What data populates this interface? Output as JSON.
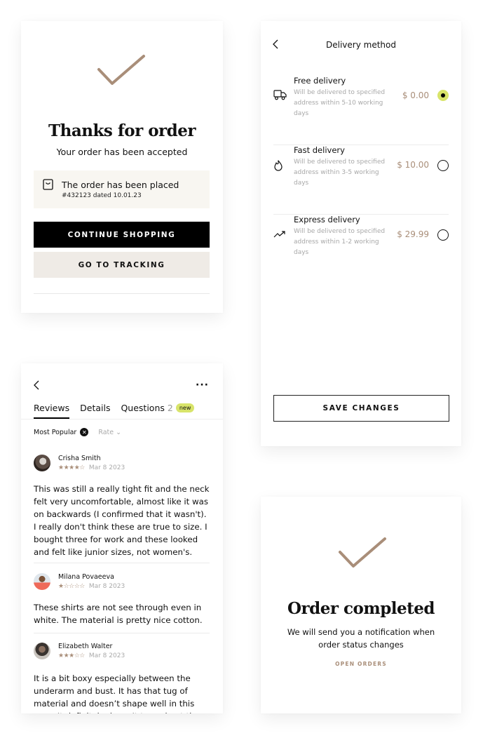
{
  "colors": {
    "accent": "#a98e79",
    "highlight": "#d8e46a",
    "panel": "#f8f6f1",
    "secondary_button": "#efebe6"
  },
  "thanks": {
    "icon": "checkmark-icon",
    "title": "Thanks for order",
    "subtitle": "Your order has been accepted",
    "placed_title": "The order has been placed",
    "placed_detail": "#432123 dated 10.01.23",
    "continue_label": "CONTINUE SHOPPING",
    "tracking_label": "GO TO TRACKING"
  },
  "delivery": {
    "title": "Delivery method",
    "options": [
      {
        "name": "Free delivery",
        "desc": "Will be delivered to specified address within 5-10 working days",
        "price": "$ 0.00",
        "icon": "truck-icon",
        "selected": true
      },
      {
        "name": "Fast delivery",
        "desc": "Will be delivered to specified address within 3-5 working days",
        "price": "$ 10.00",
        "icon": "fire-icon",
        "selected": false
      },
      {
        "name": "Express delivery",
        "desc": "Will be delivered to specified address within 1-2 working days",
        "price": "$ 29.99",
        "icon": "trending-up-icon",
        "selected": false
      }
    ],
    "save_label": "SAVE CHANGES"
  },
  "reviews": {
    "tabs": [
      {
        "label": "Reviews",
        "active": true
      },
      {
        "label": "Details",
        "active": false
      },
      {
        "label": "Questions",
        "count": "2",
        "badge": "new",
        "active": false
      }
    ],
    "filter_label": "Most Popular",
    "rate_label": "Rate",
    "items": [
      {
        "name": "Crisha Smith",
        "rating": 4,
        "stars": "★★★★☆",
        "date": "Mar 8 2023",
        "text": "This was still a really tight fit and the neck felt very uncomfortable, almost like it was on backwards (I confirmed that it wasn't). I really don't think these are true to size. I bought three for work and these looked and felt like junior sizes, not women's."
      },
      {
        "name": "Milana Povaeeva",
        "rating": 1,
        "stars": "★☆☆☆☆",
        "date": "Mar 8 2023",
        "text": "These shirts are not see through even in white. The material is pretty nice cotton."
      },
      {
        "name": "Elizabeth Walter",
        "rating": 3,
        "stars": "★★★☆☆",
        "date": "Mar 8 2023",
        "text": "It is a bit boxy especially between the underarm and bust. It has that tug of material and doesn’t shape well in this area. It definitely doesn’t taper in at the"
      }
    ]
  },
  "completed": {
    "icon": "checkmark-icon",
    "title": "Order completed",
    "subtitle": "We will send you a notification when order status changes",
    "link_label": "OPEN ORDERS"
  }
}
